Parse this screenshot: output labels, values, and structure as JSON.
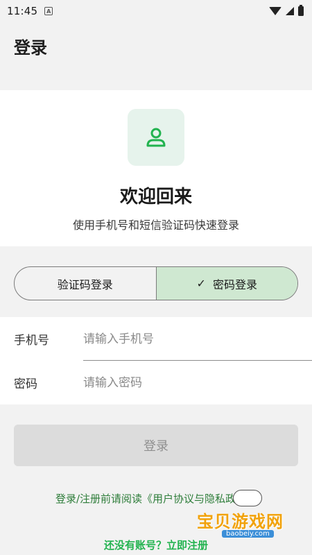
{
  "status_bar": {
    "time": "11:45",
    "notification": "A"
  },
  "app_bar": {
    "title": "登录"
  },
  "hero": {
    "title": "欢迎回来",
    "subtitle": "使用手机号和短信验证码快速登录"
  },
  "login_mode": {
    "options": [
      "验证码登录",
      "密码登录"
    ],
    "selected": "密码登录"
  },
  "form": {
    "phone": {
      "label": "手机号",
      "placeholder": "请输入手机号",
      "value": ""
    },
    "password": {
      "label": "密码",
      "placeholder": "请输入密码",
      "value": ""
    }
  },
  "login_button": {
    "label": "登录",
    "enabled": false
  },
  "agreement_text": "登录/注册前请阅读《用户协议与隐私政策》",
  "register_link": "还没有账号？立即注册",
  "watermark": {
    "text": "宝贝游戏网",
    "url": "baobeiy.com"
  },
  "colors": {
    "accent": "#22b34f",
    "selected_segment": "#cfe8d1",
    "avatar_bg": "#e6f3ec",
    "agreement_text": "#2e7d3a",
    "button_disabled": "#dcdcdc"
  }
}
